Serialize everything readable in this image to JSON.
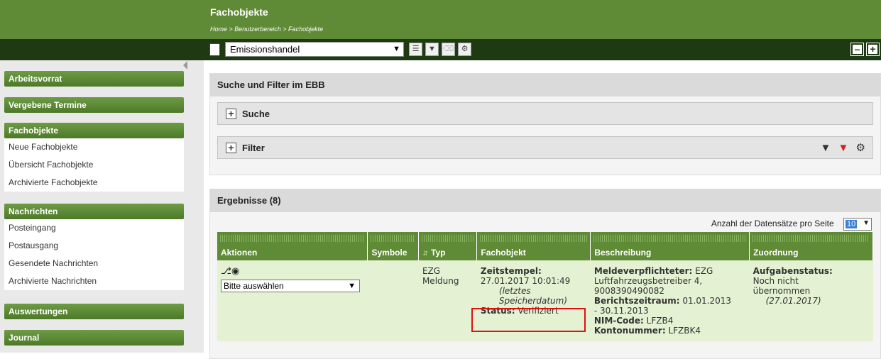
{
  "header": {
    "title": "Fachobjekte",
    "breadcrumb": "Home > Benutzerbereich > Fachobjekte"
  },
  "toolbar": {
    "category_select": "Emissionshandel"
  },
  "sidebar": {
    "groups": [
      {
        "label": "Arbeitsvorrat",
        "items": []
      },
      {
        "label": "Vergebene Termine",
        "items": []
      },
      {
        "label": "Fachobjekte",
        "items": [
          "Neue Fachobjekte",
          "Übersicht Fachobjekte",
          "Archivierte Fachobjekte"
        ]
      },
      {
        "label": "Nachrichten",
        "items": [
          "Posteingang",
          "Postausgang",
          "Gesendete Nachrichten",
          "Archivierte Nachrichten"
        ]
      },
      {
        "label": "Auswertungen",
        "items": []
      },
      {
        "label": "Journal",
        "items": []
      }
    ]
  },
  "search_panel": {
    "title": "Suche und Filter im EBB",
    "search_label": "Suche",
    "filter_label": "Filter"
  },
  "results": {
    "title": "Ergebnisse (8)",
    "per_page_label": "Anzahl der Datensätze pro Seite",
    "per_page_value": "10",
    "columns": [
      "Aktionen",
      "Symbole",
      "Typ",
      "Fachobjekt",
      "Beschreibung",
      "Zuordnung"
    ],
    "rows": [
      {
        "action_select": "Bitte auswählen",
        "typ_line1": "EZG",
        "typ_line2": "Meldung",
        "fo_ts_label": "Zeitstempel:",
        "fo_ts_value": "27.01.2017 10:01:49",
        "fo_note1": "(letztes",
        "fo_note2": "Speicherdatum)",
        "fo_status_label": "Status:",
        "fo_status_value": "Verifiziert",
        "desc_mv_label": "Meldeverpflichteter:",
        "desc_mv_value1": "EZG",
        "desc_mv_value2": "Luftfahrzeugsbetreiber 4,",
        "desc_mv_value3": "9008390490082",
        "desc_bz_label": "Berichtszeitraum:",
        "desc_bz_value1": "01.01.2013",
        "desc_bz_value2": "- 30.11.2013",
        "desc_nim_label": "NIM-Code:",
        "desc_nim_value": "LFZB4",
        "desc_kn_label": "Kontonummer:",
        "desc_kn_value": "LFZBK4",
        "zu_label": "Aufgabenstatus:",
        "zu_value1": "Noch nicht",
        "zu_value2": "übernommen",
        "zu_date": "(27.01.2017)"
      }
    ]
  }
}
